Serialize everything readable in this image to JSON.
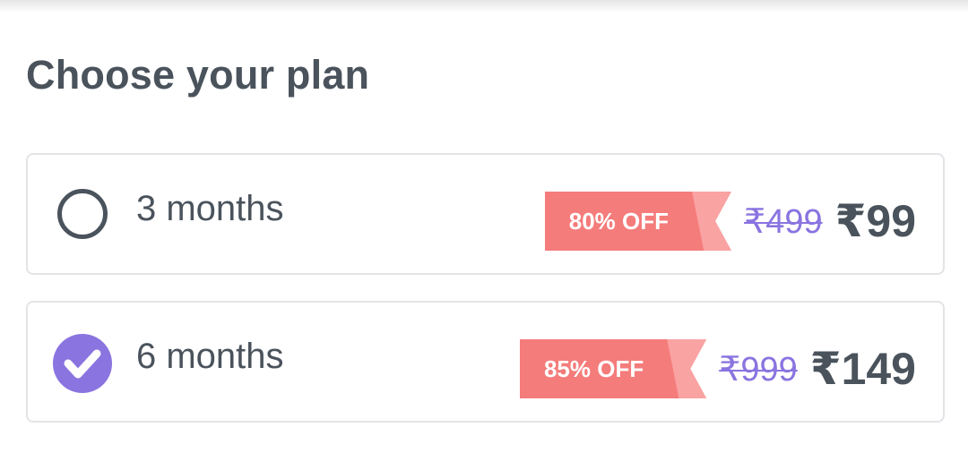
{
  "header": {
    "title": "Choose your plan"
  },
  "plans": [
    {
      "name": "3 months",
      "discount": "80% OFF",
      "old_price": "₹499",
      "new_price": "₹99",
      "selected": false
    },
    {
      "name": "6 months",
      "discount": "85% OFF",
      "old_price": "₹999",
      "new_price": "₹149",
      "selected": true
    }
  ],
  "colors": {
    "accent": "#8a74e0",
    "discount_tag": "#f47c7b",
    "text": "#4a535c",
    "border": "#e2e4e7"
  }
}
